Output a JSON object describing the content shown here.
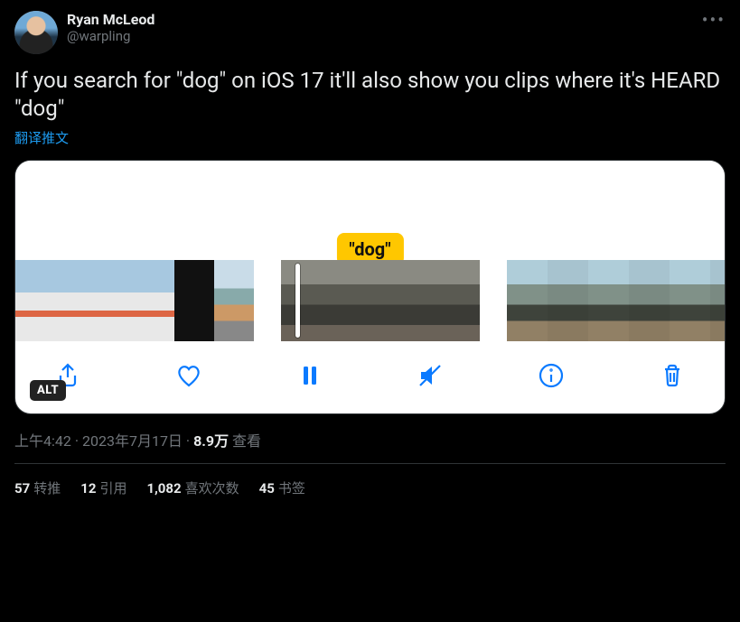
{
  "author": {
    "display_name": "Ryan McLeod",
    "handle": "@warpling"
  },
  "body_text": "If you search for \"dog\" on iOS 17 it'll also show you clips where it's HEARD \"dog\"",
  "translate_label": "翻译推文",
  "media": {
    "search_term_label": "\"dog\"",
    "alt_badge": "ALT"
  },
  "meta": {
    "time": "上午4:42",
    "date": "2023年7月17日",
    "views_count": "8.9万",
    "views_label": "查看"
  },
  "stats": {
    "retweets_n": "57",
    "retweets_label": "转推",
    "quotes_n": "12",
    "quotes_label": "引用",
    "likes_n": "1,082",
    "likes_label": "喜欢次数",
    "bookmarks_n": "45",
    "bookmarks_label": "书签"
  }
}
